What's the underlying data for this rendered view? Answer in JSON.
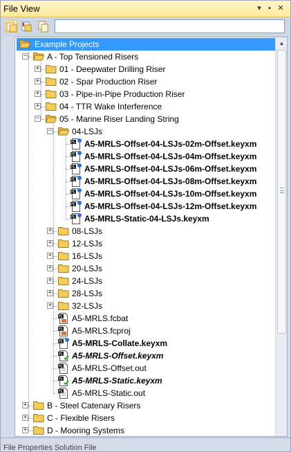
{
  "window": {
    "title": "File View"
  },
  "titlebar_buttons": {
    "dropdown": "▾",
    "pin": "▪",
    "close": "✕"
  },
  "toolbar": {
    "search_value": "",
    "search_placeholder": ""
  },
  "colors": {
    "selection": "#3399ff",
    "folder": "#f3cd5a",
    "titlebar": "#ffe89a",
    "status_check": "#22aa22",
    "status_question": "#2a6fd6"
  },
  "tree": {
    "rows": [
      {
        "label": "Example Projects",
        "level": 0,
        "icon": "folder-open-icon",
        "expander": "none",
        "style": "normal",
        "selected": true
      },
      {
        "label": "A - Top Tensioned Risers",
        "level": 1,
        "icon": "folder-open-icon",
        "expander": "minus",
        "style": "normal"
      },
      {
        "label": "01 - Deepwater Drilling Riser",
        "level": 2,
        "icon": "folder-icon",
        "expander": "plus",
        "style": "normal"
      },
      {
        "label": "02 - Spar Production Riser",
        "level": 2,
        "icon": "folder-icon",
        "expander": "plus",
        "style": "normal"
      },
      {
        "label": "03 - Pipe-in-Pipe Production Riser",
        "level": 2,
        "icon": "folder-icon",
        "expander": "plus",
        "style": "normal"
      },
      {
        "label": "04 - TTR Wake Interference",
        "level": 2,
        "icon": "folder-icon",
        "expander": "plus",
        "style": "normal"
      },
      {
        "label": "05 - Marine Riser Landing String",
        "level": 2,
        "icon": "folder-open-icon",
        "expander": "minus",
        "style": "normal"
      },
      {
        "label": "04-LSJs",
        "level": 3,
        "icon": "folder-open-icon",
        "expander": "minus",
        "style": "normal"
      },
      {
        "label": "A5-MRLS-Offset-04-LSJs-02m-Offset.keyxm",
        "level": 4,
        "icon": "keyxm-question-icon",
        "expander": "none",
        "style": "bold"
      },
      {
        "label": "A5-MRLS-Offset-04-LSJs-04m-Offset.keyxm",
        "level": 4,
        "icon": "keyxm-question-icon",
        "expander": "none",
        "style": "bold"
      },
      {
        "label": "A5-MRLS-Offset-04-LSJs-06m-Offset.keyxm",
        "level": 4,
        "icon": "keyxm-question-icon",
        "expander": "none",
        "style": "bold"
      },
      {
        "label": "A5-MRLS-Offset-04-LSJs-08m-Offset.keyxm",
        "level": 4,
        "icon": "keyxm-question-icon",
        "expander": "none",
        "style": "bold"
      },
      {
        "label": "A5-MRLS-Offset-04-LSJs-10m-Offset.keyxm",
        "level": 4,
        "icon": "keyxm-question-icon",
        "expander": "none",
        "style": "bold"
      },
      {
        "label": "A5-MRLS-Offset-04-LSJs-12m-Offset.keyxm",
        "level": 4,
        "icon": "keyxm-question-icon",
        "expander": "none",
        "style": "bold"
      },
      {
        "label": "A5-MRLS-Static-04-LSJs.keyxm",
        "level": 4,
        "icon": "keyxm-question-icon",
        "expander": "none",
        "style": "bold"
      },
      {
        "label": "08-LSJs",
        "level": 3,
        "icon": "folder-icon",
        "expander": "plus",
        "style": "normal"
      },
      {
        "label": "12-LSJs",
        "level": 3,
        "icon": "folder-icon",
        "expander": "plus",
        "style": "normal"
      },
      {
        "label": "16-LSJs",
        "level": 3,
        "icon": "folder-icon",
        "expander": "plus",
        "style": "normal"
      },
      {
        "label": "20-LSJs",
        "level": 3,
        "icon": "folder-icon",
        "expander": "plus",
        "style": "normal"
      },
      {
        "label": "24-LSJs",
        "level": 3,
        "icon": "folder-icon",
        "expander": "plus",
        "style": "normal"
      },
      {
        "label": "28-LSJs",
        "level": 3,
        "icon": "folder-icon",
        "expander": "plus",
        "style": "normal"
      },
      {
        "label": "32-LSJs",
        "level": 3,
        "icon": "folder-icon",
        "expander": "plus",
        "style": "normal"
      },
      {
        "label": "A5-MRLS.fcbat",
        "level": 3,
        "icon": "fcbat-file-icon",
        "expander": "none",
        "style": "normal"
      },
      {
        "label": "A5-MRLS.fcproj",
        "level": 3,
        "icon": "fcproj-file-icon",
        "expander": "none",
        "style": "normal"
      },
      {
        "label": "A5-MRLS-Collate.keyxm",
        "level": 3,
        "icon": "keyxm-question-icon",
        "expander": "none",
        "style": "bold"
      },
      {
        "label": "A5-MRLS-Offset.keyxm",
        "level": 3,
        "icon": "keyxm-check-icon",
        "expander": "none",
        "style": "bold-italic"
      },
      {
        "label": "A5-MRLS-Offset.out",
        "level": 3,
        "icon": "out-file-icon",
        "expander": "none",
        "style": "normal"
      },
      {
        "label": "A5-MRLS-Static.keyxm",
        "level": 3,
        "icon": "keyxm-check-icon",
        "expander": "none",
        "style": "bold-italic"
      },
      {
        "label": "A5-MRLS-Static.out",
        "level": 3,
        "icon": "out-file-icon",
        "expander": "none",
        "style": "normal"
      },
      {
        "label": "B - Steel Catenary Risers",
        "level": 1,
        "icon": "folder-icon",
        "expander": "plus",
        "style": "normal"
      },
      {
        "label": "C - Flexible Risers",
        "level": 1,
        "icon": "folder-icon",
        "expander": "plus",
        "style": "normal"
      },
      {
        "label": "D - Mooring Systems",
        "level": 1,
        "icon": "folder-icon",
        "expander": "plus",
        "style": "normal"
      }
    ]
  },
  "bottom": {
    "tab_text": "File Properties    Solution File"
  }
}
